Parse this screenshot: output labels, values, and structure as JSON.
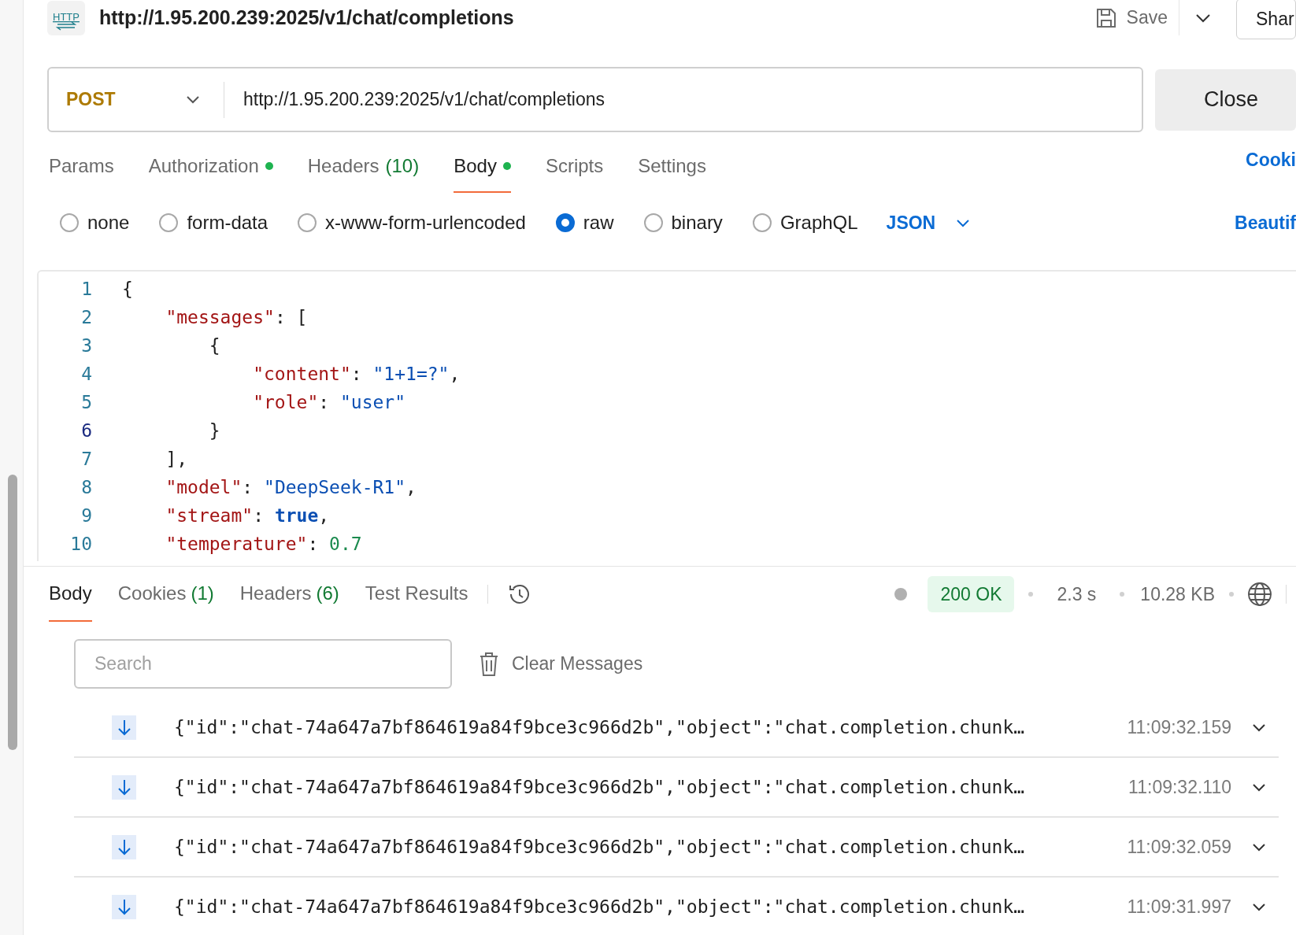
{
  "request": {
    "icon_label": "HTTP",
    "title": "http://1.95.200.239:2025/v1/chat/completions",
    "save": "Save",
    "share": "Shar",
    "method": "POST",
    "url": "http://1.95.200.239:2025/v1/chat/completions",
    "close": "Close"
  },
  "request_tabs": [
    {
      "label": "Params",
      "selected": false,
      "dot": false
    },
    {
      "label": "Authorization",
      "selected": false,
      "dot": true
    },
    {
      "label": "Headers",
      "count": "(10)",
      "selected": false,
      "dot": false
    },
    {
      "label": "Body",
      "selected": true,
      "dot": true
    },
    {
      "label": "Scripts",
      "selected": false,
      "dot": false
    },
    {
      "label": "Settings",
      "selected": false,
      "dot": false
    }
  ],
  "cookies_link": "Cooki",
  "body_types": [
    {
      "label": "none",
      "selected": false
    },
    {
      "label": "form-data",
      "selected": false
    },
    {
      "label": "x-www-form-urlencoded",
      "selected": false
    },
    {
      "label": "raw",
      "selected": true
    },
    {
      "label": "binary",
      "selected": false
    },
    {
      "label": "GraphQL",
      "selected": false
    }
  ],
  "format": "JSON",
  "beautify": "Beautif",
  "code_lines": [
    {
      "number": "1",
      "active": false,
      "tokens": [
        {
          "kind": "punct",
          "text": "{"
        }
      ]
    },
    {
      "number": "2",
      "active": false,
      "tokens": [
        {
          "kind": "key",
          "text": "    \"messages\""
        },
        {
          "kind": "punct",
          "text": ": ["
        }
      ]
    },
    {
      "number": "3",
      "active": false,
      "tokens": [
        {
          "kind": "punct",
          "text": "        {"
        }
      ]
    },
    {
      "number": "4",
      "active": false,
      "tokens": [
        {
          "kind": "key",
          "text": "            \"content\""
        },
        {
          "kind": "punct",
          "text": ": "
        },
        {
          "kind": "string",
          "text": "\"1+1=?\""
        },
        {
          "kind": "punct",
          "text": ","
        }
      ]
    },
    {
      "number": "5",
      "active": false,
      "tokens": [
        {
          "kind": "key",
          "text": "            \"role\""
        },
        {
          "kind": "punct",
          "text": ": "
        },
        {
          "kind": "string",
          "text": "\"user\""
        }
      ]
    },
    {
      "number": "6",
      "active": true,
      "tokens": [
        {
          "kind": "punct",
          "text": "        }"
        }
      ]
    },
    {
      "number": "7",
      "active": false,
      "tokens": [
        {
          "kind": "punct",
          "text": "    ],"
        }
      ]
    },
    {
      "number": "8",
      "active": false,
      "tokens": [
        {
          "kind": "key",
          "text": "    \"model\""
        },
        {
          "kind": "punct",
          "text": ": "
        },
        {
          "kind": "string",
          "text": "\"DeepSeek-R1\""
        },
        {
          "kind": "punct",
          "text": ","
        }
      ]
    },
    {
      "number": "9",
      "active": false,
      "tokens": [
        {
          "kind": "key",
          "text": "    \"stream\""
        },
        {
          "kind": "punct",
          "text": ": "
        },
        {
          "kind": "bool",
          "text": "true"
        },
        {
          "kind": "punct",
          "text": ","
        }
      ]
    },
    {
      "number": "10",
      "active": false,
      "tokens": [
        {
          "kind": "key",
          "text": "    \"temperature\""
        },
        {
          "kind": "punct",
          "text": ": "
        },
        {
          "kind": "number",
          "text": "0.7"
        }
      ]
    }
  ],
  "response": {
    "tabs": [
      {
        "label": "Body",
        "selected": true
      },
      {
        "label": "Cookies",
        "count": "(1)",
        "selected": false
      },
      {
        "label": "Headers",
        "count": "(6)",
        "selected": false
      },
      {
        "label": "Test Results",
        "selected": false
      }
    ],
    "status": "200 OK",
    "time": "2.3 s",
    "size": "10.28 KB",
    "search": {
      "placeholder": "Search"
    },
    "clear": "Clear Messages",
    "messages": [
      {
        "text": "{\"id\":\"chat-74a647a7bf864619a84f9bce3c966d2b\",\"object\":\"chat.completion.chunk…",
        "time": "11:09:32.159"
      },
      {
        "text": "{\"id\":\"chat-74a647a7bf864619a84f9bce3c966d2b\",\"object\":\"chat.completion.chunk…",
        "time": "11:09:32.110"
      },
      {
        "text": "{\"id\":\"chat-74a647a7bf864619a84f9bce3c966d2b\",\"object\":\"chat.completion.chunk…",
        "time": "11:09:32.059"
      },
      {
        "text": "{\"id\":\"chat-74a647a7bf864619a84f9bce3c966d2b\",\"object\":\"chat.completion.chunk…",
        "time": "11:09:31.997"
      }
    ]
  }
}
